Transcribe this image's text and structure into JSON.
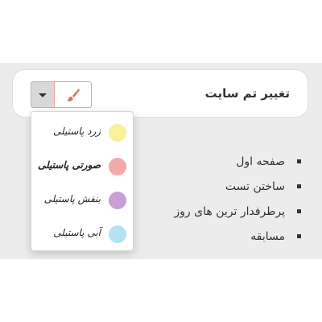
{
  "theme_panel": {
    "title": "تغییر تم سایت",
    "icon": "paintbrush-icon",
    "accent": "#e06c6c"
  },
  "theme_options": [
    {
      "label": "زرد پاستیلی",
      "color": "#f6f29a",
      "selected": false
    },
    {
      "label": "صورتی پاستیلی",
      "color": "#f2aaaa",
      "selected": true
    },
    {
      "label": "بنفش پاستیلی",
      "color": "#c9a0d6",
      "selected": false
    },
    {
      "label": "آبی پاستیلی",
      "color": "#b3e3f2",
      "selected": false
    }
  ],
  "nav": {
    "items": [
      "صفحه اول",
      "ساختن تست",
      "پرطرفدار ترین های روز",
      "مسابقه"
    ]
  }
}
